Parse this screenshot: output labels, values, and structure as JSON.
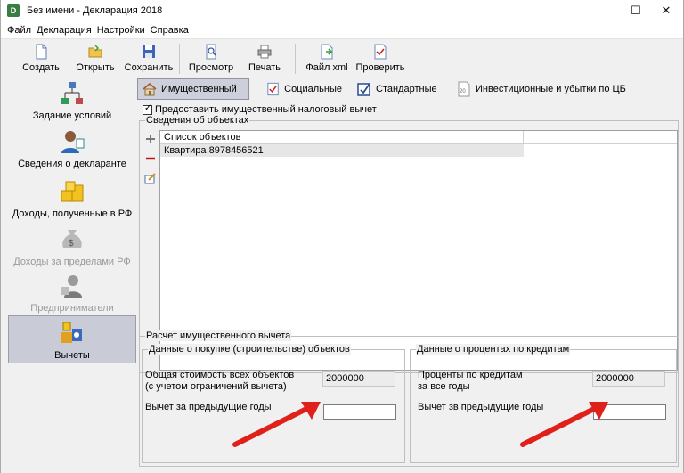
{
  "window": {
    "title": "Без имени - Декларация 2018",
    "app_icon_glyph": "D",
    "controls": {
      "minimize": "—",
      "maximize": "☐",
      "close": "✕"
    }
  },
  "menu": [
    "Файл",
    "Декларация",
    "Настройки",
    "Справка"
  ],
  "toolbar": {
    "create": "Создать",
    "open": "Открыть",
    "save": "Сохранить",
    "preview": "Просмотр",
    "print": "Печать",
    "xml": "Файл xml",
    "check": "Проверить"
  },
  "sidebar": [
    {
      "label": "Задание условий",
      "icon": "conditions-icon",
      "state": "normal"
    },
    {
      "label": "Сведения о декларанте",
      "icon": "declarant-icon",
      "state": "normal"
    },
    {
      "label": "Доходы, полученные в РФ",
      "icon": "coins-icon",
      "state": "normal"
    },
    {
      "label": "Доходы за пределами РФ",
      "icon": "money-bag-icon",
      "state": "disabled"
    },
    {
      "label": "Предприниматели",
      "icon": "entrepreneur-icon",
      "state": "disabled"
    },
    {
      "label": "Вычеты",
      "icon": "deductions-icon",
      "state": "selected"
    }
  ],
  "tabs": [
    {
      "label": "Имущественный",
      "icon": "house-icon",
      "active": true
    },
    {
      "label": "Социальные",
      "icon": "checklist-icon",
      "active": false
    },
    {
      "label": "Стандартные",
      "icon": "standard-icon",
      "active": false
    },
    {
      "label": "Инвестиционные и убытки по ЦБ",
      "icon": "document-20-icon",
      "active": false
    }
  ],
  "property_checkbox": {
    "label": "Предоставить имущественный налоговый вычет",
    "checked": true
  },
  "objects": {
    "group_title": "Сведения об объектах",
    "column_header": "Список объектов",
    "rows": [
      "Квартира 8978456521"
    ]
  },
  "calc": {
    "group_title": "Расчет имущественного вычета",
    "purchase": {
      "title": "Данные о покупке (строительстве) объектов",
      "total_label_line1": "Общая стоимость всех объектов",
      "total_label_line2": "(с учетом ограничений вычета)",
      "total_value": "2000000",
      "prev_label": "Вычет за предыдущие годы",
      "prev_value": ""
    },
    "interest": {
      "title": "Данные о процентах по кредитам",
      "total_label_line1": "Проценты по кредитам",
      "total_label_line2": "за все годы",
      "total_value": "2000000",
      "prev_label": "Вычет зв предыдущие годы",
      "prev_value": ""
    }
  },
  "colors": {
    "arrow": "#e0201b",
    "selected_bg": "#c9ccd6"
  }
}
